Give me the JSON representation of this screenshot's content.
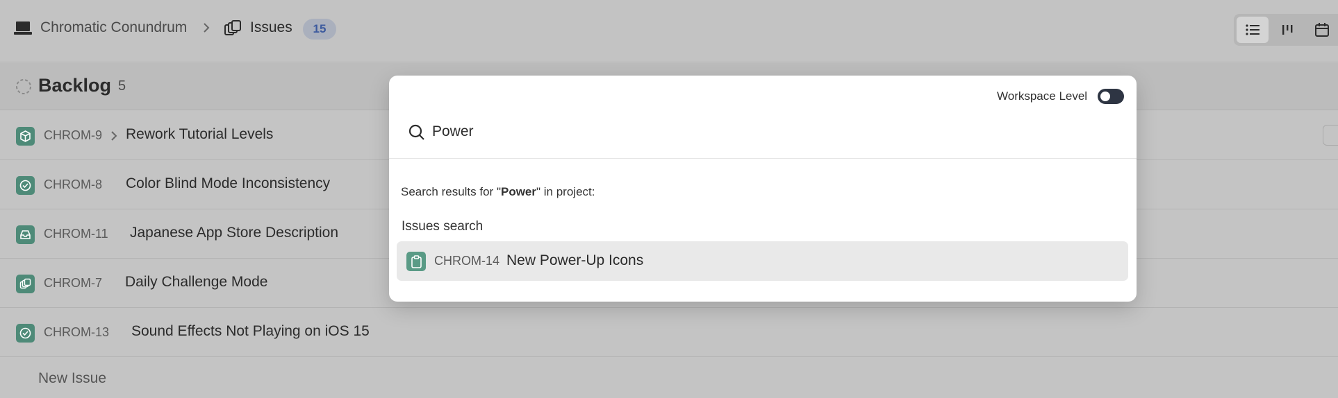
{
  "header": {
    "project_name": "Chromatic Conundrum",
    "project_icon": "laptop-icon",
    "section_label": "Issues",
    "section_icon": "issues-stack-icon",
    "issue_count": "15",
    "views": [
      {
        "name": "list-view-icon",
        "active": true
      },
      {
        "name": "board-view-icon",
        "active": false
      },
      {
        "name": "calendar-view-icon",
        "active": false
      }
    ]
  },
  "group": {
    "title": "Backlog",
    "count": "5",
    "icon": "backlog-dashed-circle-icon"
  },
  "rows": [
    {
      "key": "CHROM-9",
      "title": "Rework Tutorial Levels",
      "icon": "cube-icon",
      "has_subissues": true
    },
    {
      "key": "CHROM-8",
      "title": "Color Blind Mode Inconsistency",
      "icon": "check-circle-icon"
    },
    {
      "key": "CHROM-11",
      "title": "Japanese App Store Description",
      "icon": "inbox-icon"
    },
    {
      "key": "CHROM-7",
      "title": "Daily Challenge Mode",
      "icon": "stack-icon"
    },
    {
      "key": "CHROM-13",
      "title": "Sound Effects Not Playing on iOS 15",
      "icon": "check-circle-icon"
    }
  ],
  "new_issue_label": "New Issue",
  "modal": {
    "workspace_toggle_label": "Workspace Level",
    "workspace_toggle_on": false,
    "search_value": "Power",
    "results_prefix": "Search results for \"",
    "results_query": "Power",
    "results_suffix": "\" in project:",
    "section_heading": "Issues search",
    "results": [
      {
        "key": "CHROM-14",
        "title": "New Power-Up Icons",
        "icon": "clipboard-icon"
      }
    ]
  },
  "colors": {
    "accent_badge": "#3c5a9e",
    "issue_icon_bg": "#4e8a78",
    "toggle_bg": "#2e3543"
  }
}
